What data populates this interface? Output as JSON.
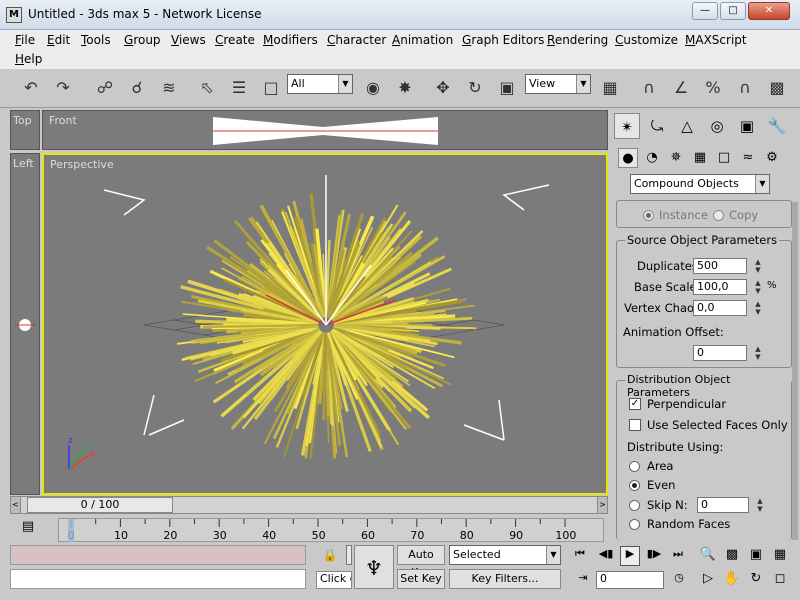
{
  "window": {
    "title": "Untitled - 3ds max 5 - Network License",
    "app_icon": "M"
  },
  "menu": [
    {
      "label": "File"
    },
    {
      "label": "Edit"
    },
    {
      "label": "Tools"
    },
    {
      "label": "Group"
    },
    {
      "label": "Views"
    },
    {
      "label": "Create"
    },
    {
      "label": "Modifiers"
    },
    {
      "label": "Character"
    },
    {
      "label": "Animation"
    },
    {
      "label": "Graph Editors"
    },
    {
      "label": "Rendering"
    },
    {
      "label": "Customize"
    },
    {
      "label": "MAXScript"
    },
    {
      "label": "Help"
    }
  ],
  "toolbar": {
    "selection_filter": "All",
    "reference_coord": "View"
  },
  "viewports": {
    "top_label": "Top",
    "front_label": "Front",
    "left_label": "Left",
    "perspective_label": "Perspective"
  },
  "command_panel": {
    "category_dropdown": "Compound Objects",
    "instance_label": "Instance",
    "copy_label": "Copy",
    "source_rollout": {
      "title": "Source Object Parameters",
      "duplicates_label": "Duplicates:",
      "duplicates_value": "500",
      "base_scale_label": "Base Scale:",
      "base_scale_value": "100,0",
      "base_scale_unit": "%",
      "vertex_chaos_label": "Vertex Chaos:",
      "vertex_chaos_value": "0,0",
      "animation_offset_label": "Animation Offset:",
      "animation_offset_value": "0"
    },
    "distribution_rollout": {
      "title": "Distribution Object Parameters",
      "perpendicular_label": "Perpendicular",
      "perpendicular_checked": true,
      "selected_faces_label": "Use Selected Faces Only",
      "selected_faces_checked": false,
      "distribute_using_label": "Distribute Using:",
      "area_label": "Area",
      "even_label": "Even",
      "skip_label": "Skip N:",
      "skip_value": "0",
      "random_faces_label": "Random Faces"
    }
  },
  "timeline": {
    "slider_label": "0 / 100",
    "ticks": [
      "0",
      "10",
      "20",
      "30",
      "40",
      "50",
      "60",
      "70",
      "80",
      "90",
      "100"
    ]
  },
  "status": {
    "prompt_text": "Click o",
    "auto_key_label": "Auto Key",
    "set_key_label": "Set Key",
    "key_mode_dropdown": "Selected",
    "key_filters_label": "Key Filters...",
    "frame_value": "0"
  }
}
